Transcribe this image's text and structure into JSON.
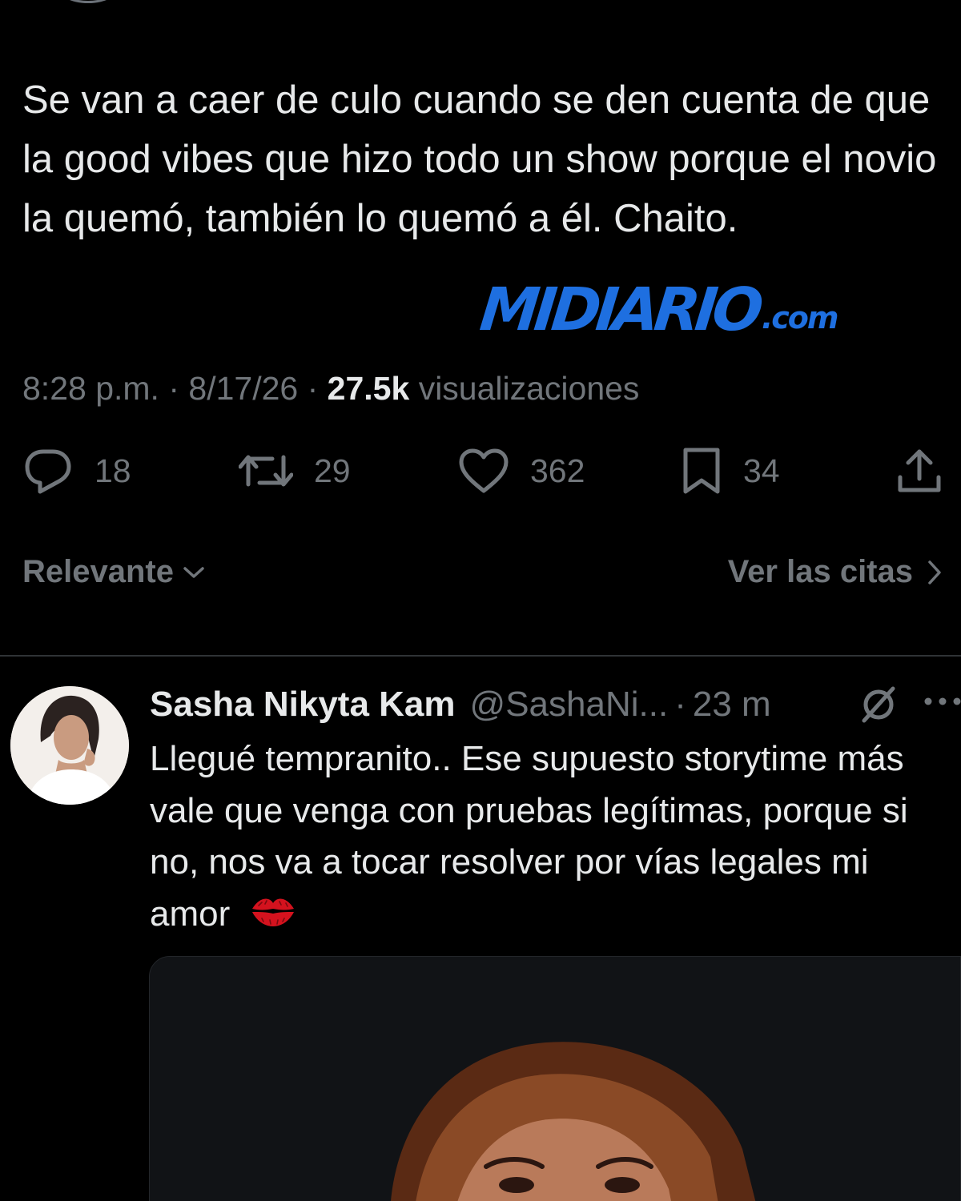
{
  "tweet": {
    "text": "Se van a caer de culo cuando se den cuenta de que la good vibes que hizo todo un show porque el novio la quemó, también lo quemó a él. Chaito.",
    "time": "8:28 p.m.",
    "date": "8/17/26",
    "separator": "·",
    "views_count": "27.5k",
    "views_label": "visualizaciones"
  },
  "watermark": {
    "main": "MIDIARIO",
    "suffix": ".com"
  },
  "actions": {
    "replies": "18",
    "reposts": "29",
    "likes": "362",
    "bookmarks": "34"
  },
  "sort_label": "Relevante",
  "quotes_label": "Ver las citas",
  "reply": {
    "name": "Sasha Nikyta Kam",
    "handle": "@SashaNi...",
    "separator": "·",
    "time": "23 m",
    "text": "Llegué tempranito.. Ese supuesto storytime más vale que venga con pruebas legítimas, porque si no, nos va a tocar resolver por vías legales mi amor"
  },
  "icons": {
    "reply": "comment-icon",
    "repost": "repost-icon",
    "like": "heart-icon",
    "bookmark": "bookmark-icon",
    "share": "share-icon",
    "grok": "grok-icon",
    "more": "more-icon",
    "emoji": "kiss-mark-icon"
  },
  "colors": {
    "background": "#000000",
    "text": "#e7e9ea",
    "muted": "#71767b",
    "watermark": "#1e6fe0",
    "kiss": "#d4121e"
  }
}
